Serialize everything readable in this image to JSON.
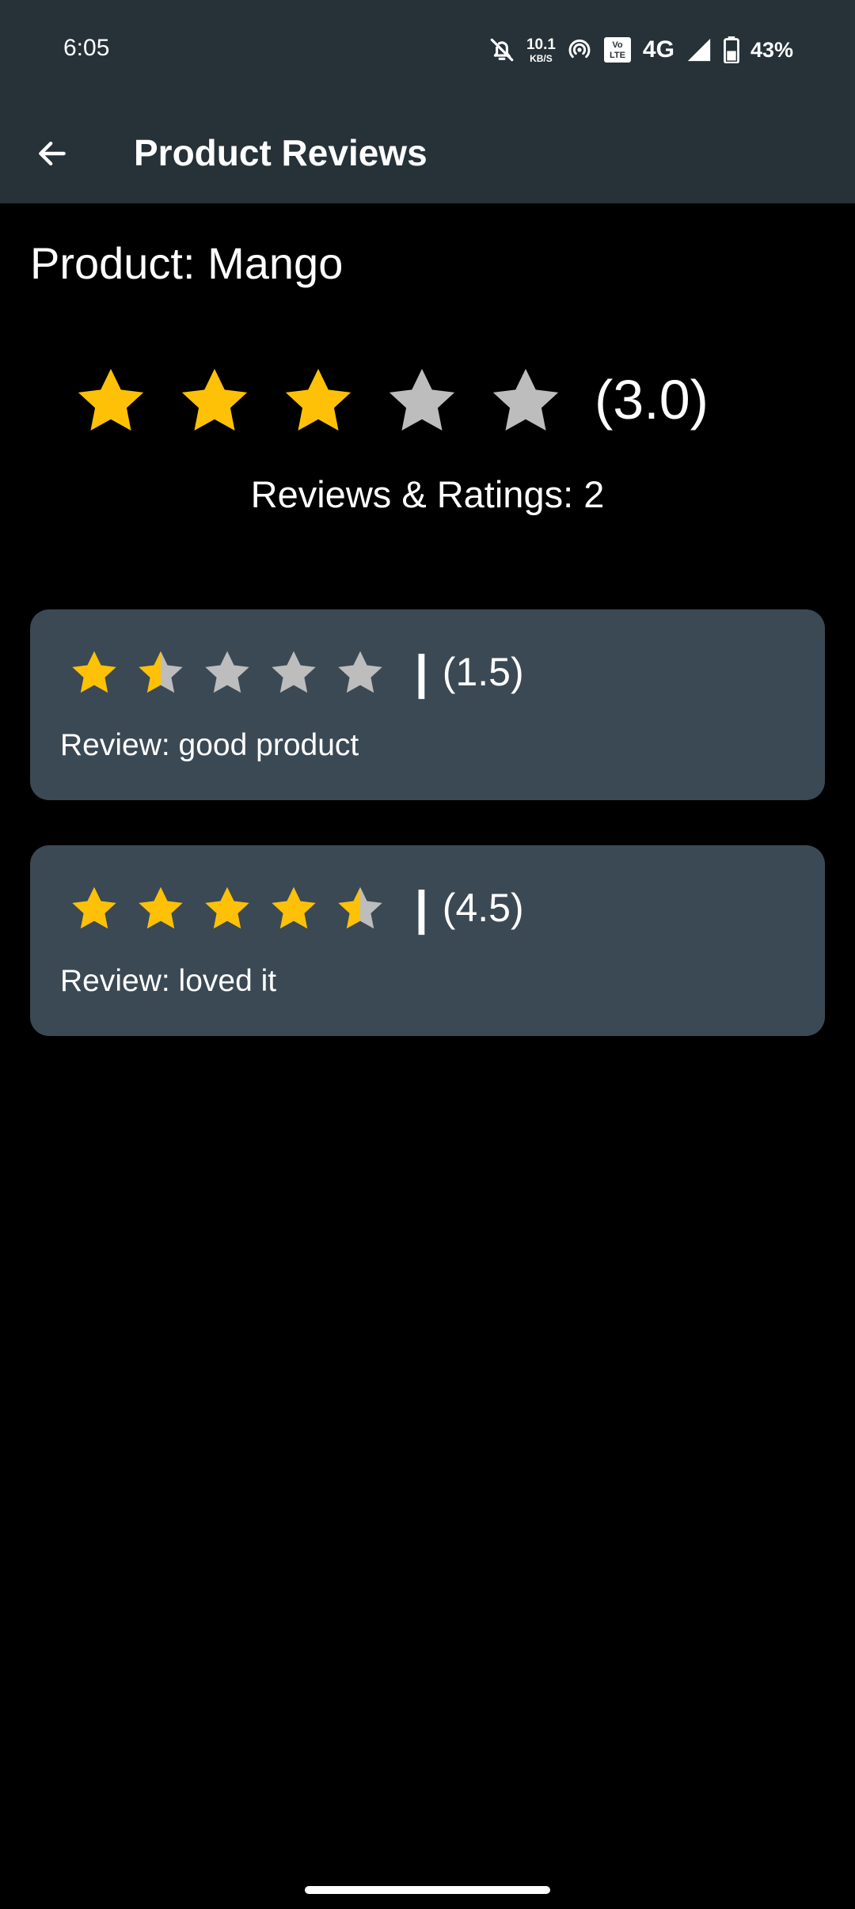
{
  "status_bar": {
    "time": "6:05",
    "net_speed_value": "10.1",
    "net_speed_unit": "KB/S",
    "volte_label": "Vo\nLTE",
    "network": "4G",
    "battery": "43%",
    "icons": [
      "mute-icon",
      "hotspot-icon",
      "volte-icon",
      "signal-icon",
      "battery-icon"
    ]
  },
  "app_bar": {
    "title": "Product Reviews",
    "back_icon": "arrow-back-icon"
  },
  "product": {
    "label": "Product: Mango",
    "average_rating": 3.0,
    "average_display": "(3.0)",
    "reviews_label": "Reviews & Ratings: 2"
  },
  "reviews": [
    {
      "rating": 1.5,
      "score_display": "(1.5)",
      "separator": "|",
      "text": "Review: good product"
    },
    {
      "rating": 4.5,
      "score_display": "(4.5)",
      "separator": "|",
      "text": "Review: loved it"
    }
  ],
  "colors": {
    "star_filled": "#FFC107",
    "star_empty": "#BDBDBD",
    "card_bg": "#3B4954",
    "bar_bg": "#263238"
  }
}
